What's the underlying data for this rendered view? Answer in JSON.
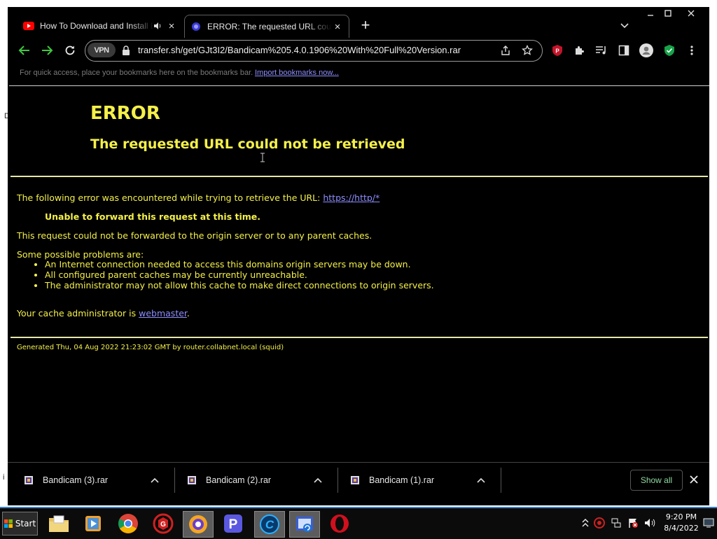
{
  "tabs": [
    {
      "title": "How To Download and Install Bandicam",
      "active": false,
      "favicon": "youtube-icon"
    },
    {
      "title": "ERROR: The requested URL could not be retrieved",
      "active": true,
      "favicon": "globe-icon"
    }
  ],
  "toolbar": {
    "vpn_label": "VPN",
    "url": "transfer.sh/get/GJt3I2/Bandicam%205.4.0.1906%20With%20Full%20Version.rar"
  },
  "bookmarks_bar": {
    "hint": "For quick access, place your bookmarks here on the bookmarks bar.",
    "import_link": "Import bookmarks now..."
  },
  "page": {
    "heading": "ERROR",
    "subheading": "The requested URL could not be retrieved",
    "intro": "The following error was encountered while trying to retrieve the URL: ",
    "intro_link": "https://http/*",
    "error_strong": "Unable to forward this request at this time.",
    "detail": "This request could not be forwarded to the origin server or to any parent caches.",
    "problems_intro": "Some possible problems are:",
    "problems": [
      "An Internet connection needed to access this domains origin servers may be down.",
      "All configured parent caches may be currently unreachable.",
      "The administrator may not allow this cache to make direct connections to origin servers."
    ],
    "admin_prefix": "Your cache administrator is ",
    "admin_link": "webmaster",
    "admin_suffix": ".",
    "generated": "Generated Thu, 04 Aug 2022 21:23:02 GMT by router.collabnet.local (squid)"
  },
  "downloads": {
    "items": [
      "Bandicam (3).rar",
      "Bandicam (2).rar",
      "Bandicam (1).rar"
    ],
    "show_all": "Show all"
  },
  "taskbar": {
    "start_label": "Start",
    "apps": [
      "file-explorer-icon",
      "media-player-icon",
      "chrome-icon",
      "game-app-icon",
      "browser-app-icon",
      "p-app-icon",
      "c-app-icon",
      "image-app-icon",
      "opera-icon"
    ],
    "time": "9:20 PM",
    "date": "8/4/2022"
  },
  "colors": {
    "error_text": "#f4f04a",
    "link": "#8d8dff",
    "nav_green": "#3ec93e",
    "show_all_text": "#8fd9a0",
    "taskbar_accent": "#3a7fd0"
  }
}
